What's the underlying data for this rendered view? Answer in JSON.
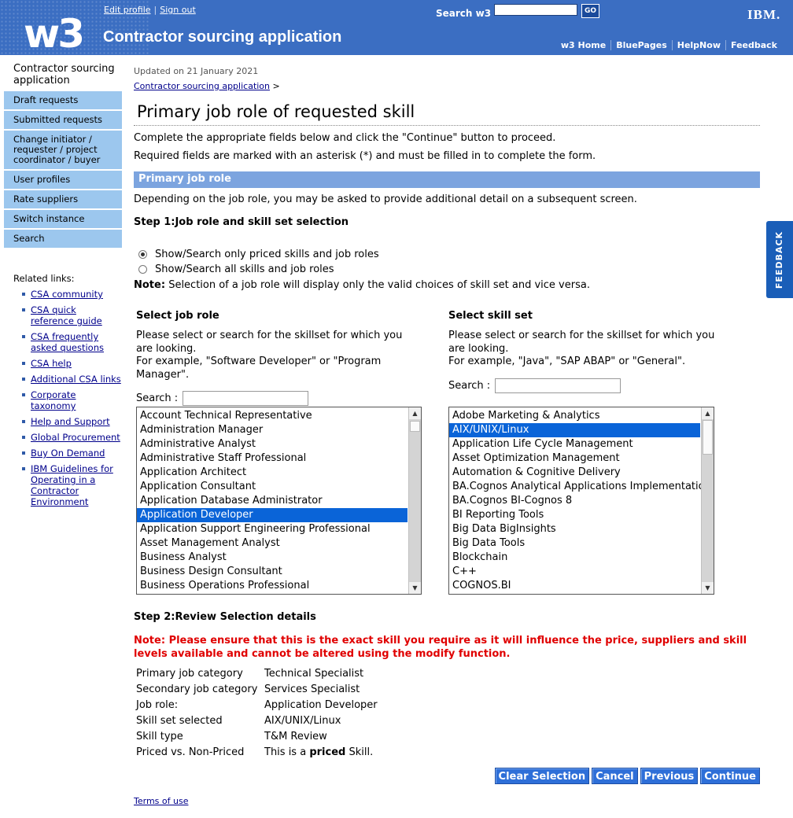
{
  "masthead": {
    "logo": "w3",
    "app_title": "Contractor sourcing application",
    "edit_profile": "Edit profile",
    "sign_out": "Sign out",
    "search_label": "Search w3",
    "go_label": "GO",
    "ibm": "IBM.",
    "nav": [
      "w3 Home",
      "BluePages",
      "HelpNow",
      "Feedback"
    ]
  },
  "sidebar": {
    "title": "Contractor sourcing application",
    "items": [
      "Draft requests",
      "Submitted requests",
      "Change initiator / requester / project coordinator / buyer",
      "User profiles",
      "Rate suppliers",
      "Switch instance",
      "Search"
    ],
    "related_title": "Related links:",
    "related_links": [
      "CSA community",
      "CSA quick reference guide",
      "CSA frequently asked questions",
      "CSA help",
      "Additional CSA links",
      "Corporate taxonomy",
      "Help and Support",
      "Global Procurement",
      "Buy On Demand",
      "IBM Guidelines for Operating in a Contractor Environment"
    ]
  },
  "main": {
    "updated": "Updated on 21 January 2021",
    "breadcrumb": "Contractor sourcing application",
    "breadcrumb_sep": ">",
    "title": "Primary job role of requested skill",
    "instruction_1": "Complete the appropriate fields below and click the \"Continue\" button to proceed.",
    "instruction_2": "Required fields are marked with an asterisk (*) and must be filled in to complete the form.",
    "section_title": "Primary job role",
    "section_desc": "Depending on the job role, you may be asked to provide additional detail on a subsequent screen.",
    "step1": "Step 1:Job role and skill set selection",
    "radio_priced": "Show/Search only priced skills and job roles",
    "radio_all": "Show/Search all skills and job roles",
    "note_label": "Note:",
    "note_text": "Selection of a job role will display only the valid choices of skill set and vice versa.",
    "job_role": {
      "heading": "Select job role",
      "desc": "Please select or search for the skillset for which you are looking.",
      "example": "For example, \"Software Developer\" or \"Program Manager\".",
      "search_label": "Search :",
      "options": [
        "Account Technical Representative",
        "Administration Manager",
        "Administrative Analyst",
        "Administrative Staff Professional",
        "Application Architect",
        "Application Consultant",
        "Application Database Administrator",
        "Application Developer",
        "Application Support Engineering Professional",
        "Asset Management Analyst",
        "Business Analyst",
        "Business Design Consultant",
        "Business Operations Professional"
      ],
      "selected": "Application Developer"
    },
    "skill_set": {
      "heading": "Select skill set",
      "desc": "Please select or search for the skillset for which you are looking.",
      "example": "For example, \"Java\", \"SAP ABAP\" or \"General\".",
      "search_label": "Search :",
      "options": [
        "Adobe Marketing & Analytics",
        "AIX/UNIX/Linux",
        "Application Life Cycle Management",
        "Asset Optimization Management",
        "Automation & Cognitive Delivery",
        "BA.Cognos Analytical Applications Implementation",
        "BA.Cognos BI-Cognos 8",
        "BI Reporting Tools",
        "Big Data BigInsights",
        "Big Data Tools",
        "Blockchain",
        "C++",
        "COGNOS.BI"
      ],
      "selected": "AIX/UNIX/Linux"
    },
    "step2": "Step 2:Review Selection details",
    "red_note": "Note: Please ensure that this is the exact skill you require as it will influence the price, suppliers and skill levels available and cannot be altered using the modify function.",
    "details": [
      {
        "label": "Primary job category",
        "value": "Technical Specialist"
      },
      {
        "label": "Secondary job category",
        "value": "Services Specialist"
      },
      {
        "label": "Job role:",
        "value": "Application Developer"
      },
      {
        "label": "Skill set selected",
        "value": "AIX/UNIX/Linux"
      },
      {
        "label": "Skill type",
        "value": "T&M Review"
      }
    ],
    "priced_label": "Priced vs. Non-Priced",
    "priced_pre": "This is a",
    "priced_bold": "priced",
    "priced_post": "Skill.",
    "buttons": [
      "Clear Selection",
      "Cancel",
      "Previous",
      "Continue"
    ],
    "terms": "Terms of use"
  },
  "feedback_tab": "FEEDBACK"
}
